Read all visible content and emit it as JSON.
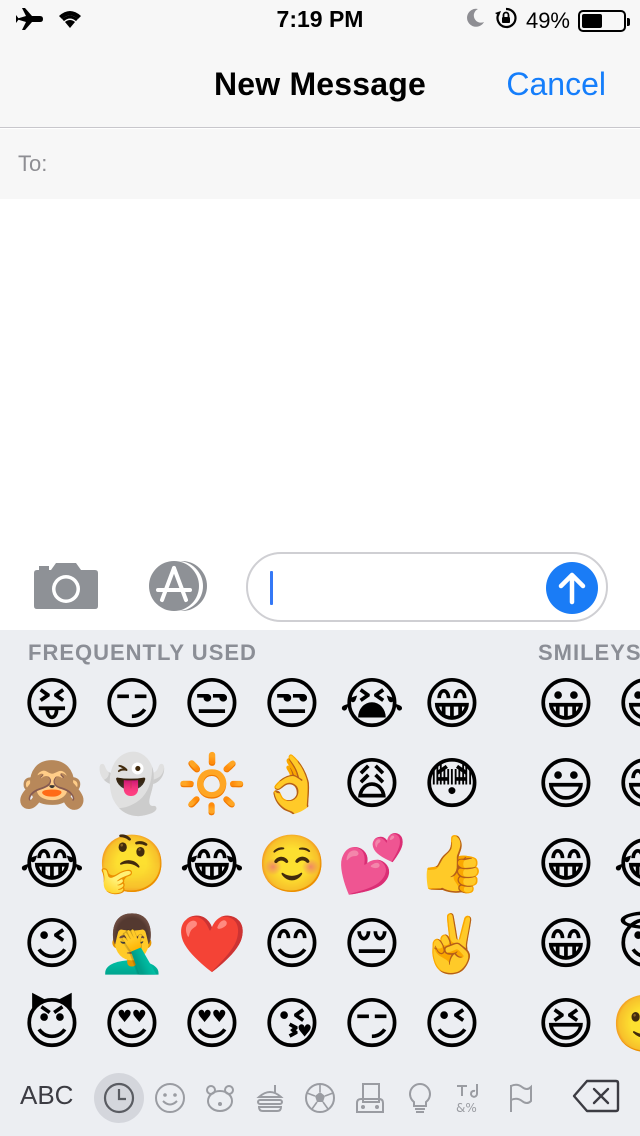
{
  "status_bar": {
    "time": "7:19 PM",
    "battery_percent": "49%",
    "battery_level": 0.49,
    "icons": [
      "airplane-icon",
      "wifi-icon",
      "moon-icon",
      "rotation-lock-icon",
      "battery-icon"
    ]
  },
  "nav": {
    "title": "New Message",
    "cancel_label": "Cancel"
  },
  "to_field": {
    "label": "To:",
    "value": ""
  },
  "composer": {
    "message_value": "",
    "accent_color": "#1a7cf6"
  },
  "keyboard": {
    "sections": [
      {
        "label": "FREQUENTLY USED"
      },
      {
        "label": "SMILEYS"
      }
    ],
    "frequent_emojis": [
      [
        "😝",
        "😏",
        "😒",
        "😒",
        "😭",
        "😁"
      ],
      [
        "🙈",
        "👻",
        "🔆",
        "👌",
        "😩",
        "😳"
      ],
      [
        "😂",
        "🤔",
        "😂",
        "☺️",
        "💕",
        "👍"
      ],
      [
        "😉",
        "🤦‍♂️",
        "❤️",
        "😊",
        "😔",
        "✌️"
      ],
      [
        "😈",
        "😍",
        "😍",
        "😘",
        "😏",
        "😉"
      ]
    ],
    "smileys_emojis": [
      [
        "😀",
        "😃"
      ],
      [
        "😃",
        "😅"
      ],
      [
        "😁",
        "😂"
      ],
      [
        "😁",
        "😇"
      ],
      [
        "😆",
        "🙂"
      ]
    ],
    "abc_label": "ABC",
    "categories": [
      "recent-clock-icon",
      "smiley-icon",
      "animal-icon",
      "food-icon",
      "activity-ball-icon",
      "travel-icon",
      "objects-bulb-icon",
      "symbols-icon",
      "flag-icon"
    ],
    "active_category": "recent-clock-icon"
  }
}
